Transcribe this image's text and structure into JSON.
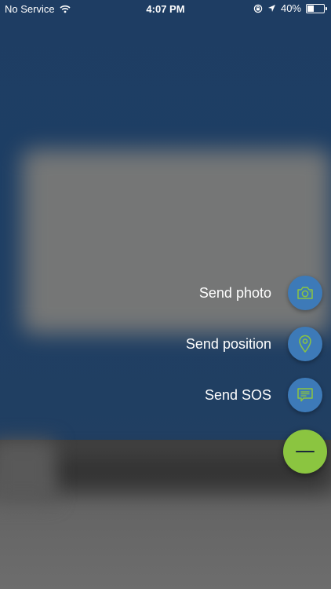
{
  "status_bar": {
    "carrier": "No Service",
    "time": "4:07 PM",
    "battery_percent": "40%",
    "battery_level": 0.4,
    "icons": [
      "wifi-icon",
      "orientation-lock-icon",
      "location-arrow-icon",
      "battery-icon"
    ]
  },
  "actions": [
    {
      "label": "Send photo",
      "icon": "camera-icon"
    },
    {
      "label": "Send position",
      "icon": "map-pin-icon"
    },
    {
      "label": "Send SOS",
      "icon": "message-icon"
    }
  ],
  "fab": {
    "icon": "minus-icon"
  },
  "colors": {
    "action_button": "#3d7ab8",
    "action_icon": "#8bc540",
    "fab": "#8bc540",
    "background_top": "#1e3d63",
    "background_bottom": "#6d6d6d"
  }
}
